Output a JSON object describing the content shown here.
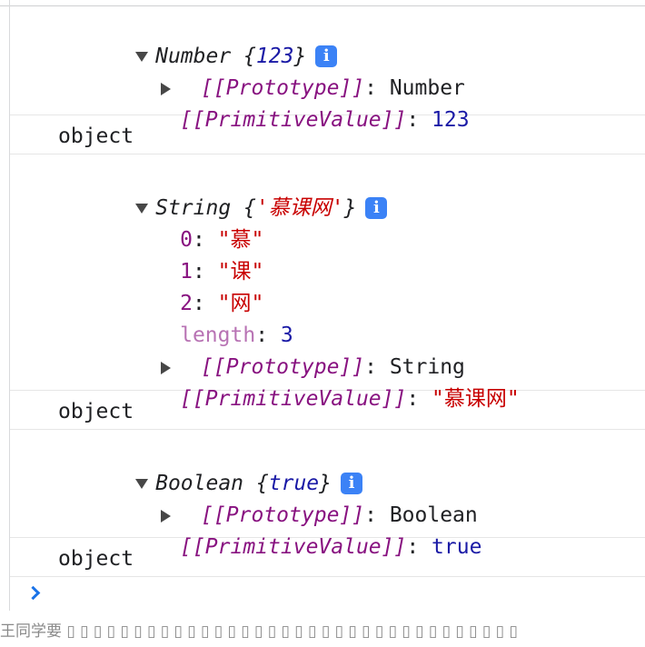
{
  "console": {
    "number_obj": {
      "class": "Number",
      "brace_open": "{",
      "value": "123",
      "brace_close": "}",
      "info": "i",
      "proto_key": "[[Prototype]]",
      "proto_val": "Number",
      "prim_key": "[[PrimitiveValue]]",
      "prim_val": "123"
    },
    "typeof_1": "object",
    "string_obj": {
      "class": "String",
      "brace_open": "{",
      "value": "'慕课网'",
      "brace_close": "}",
      "info": "i",
      "entries": [
        {
          "key": "0",
          "value": "\"慕\""
        },
        {
          "key": "1",
          "value": "\"课\""
        },
        {
          "key": "2",
          "value": "\"网\""
        }
      ],
      "length_key": "length",
      "length_val": "3",
      "proto_key": "[[Prototype]]",
      "proto_val": "String",
      "prim_key": "[[PrimitiveValue]]",
      "prim_val": "\"慕课网\""
    },
    "typeof_2": "object",
    "boolean_obj": {
      "class": "Boolean",
      "brace_open": "{",
      "value": "true",
      "brace_close": "}",
      "info": "i",
      "proto_key": "[[Prototype]]",
      "proto_val": "Boolean",
      "prim_key": "[[PrimitiveValue]]",
      "prim_val": "true"
    },
    "typeof_3": "object"
  },
  "watermark": "王同学要 ▯ ▯ ▯ ▯ ▯ ▯ ▯ ▯ ▯ ▯ ▯ ▯ ▯ ▯ ▯ ▯ ▯ ▯ ▯ ▯ ▯ ▯ ▯ ▯ ▯ ▯ ▯ ▯ ▯ ▯ ▯ ▯ ▯ ▯"
}
